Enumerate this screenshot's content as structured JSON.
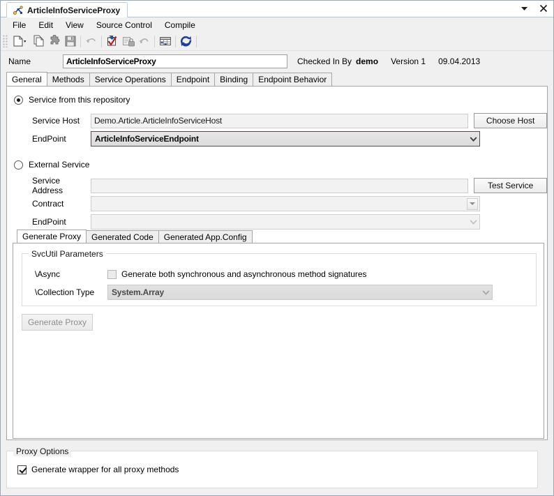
{
  "window": {
    "tab_title": "ArticleInfoServiceProxy",
    "tab_icon": "service-node-icon",
    "dropdown_icon": "chevron-down-icon",
    "close_icon": "close-icon"
  },
  "menu": {
    "items": [
      {
        "label": "File"
      },
      {
        "label": "Edit"
      },
      {
        "label": "View"
      },
      {
        "label": "Source Control"
      },
      {
        "label": "Compile"
      }
    ]
  },
  "toolbar": {
    "buttons": [
      {
        "name": "new-icon",
        "title": "New"
      },
      {
        "name": "copy-icon",
        "title": "Copy"
      },
      {
        "name": "plugin-icon",
        "title": "Add-in"
      },
      {
        "name": "save-icon",
        "title": "Save"
      },
      {
        "name": "undo-icon",
        "title": "Undo"
      },
      {
        "name": "check-in-icon",
        "title": "Check In"
      },
      {
        "name": "check-out-lock-icon",
        "title": "Check Out"
      },
      {
        "name": "undo-checkout-icon",
        "title": "Undo Check Out"
      },
      {
        "name": "grid-icon",
        "title": "Grid"
      },
      {
        "name": "refresh-icon",
        "title": "Refresh"
      }
    ]
  },
  "name_row": {
    "label": "Name",
    "value": "ArticleInfoServiceProxy",
    "placeholder": "",
    "checked_in_by_label": "Checked In By",
    "checked_in_by_user": "demo",
    "version": "Version 1",
    "date": "09.04.2013"
  },
  "tabs": {
    "items": [
      {
        "label": "General",
        "active": true
      },
      {
        "label": "Methods",
        "active": false
      },
      {
        "label": "Service Operations",
        "active": false
      },
      {
        "label": "Endpoint",
        "active": false
      },
      {
        "label": "Binding",
        "active": false
      },
      {
        "label": "Endpoint Behavior",
        "active": false
      }
    ]
  },
  "general": {
    "repository_radio": {
      "label": "Service from this repository",
      "checked": true
    },
    "service_host": {
      "label": "Service Host",
      "value": "Demo.Article.ArticleInfoServiceHost",
      "placeholder": ""
    },
    "choose_host_button": "Choose Host",
    "endpoint": {
      "label": "EndPoint",
      "value": "ArticleInfoServiceEndpoint",
      "chevron": "chevron-down-icon"
    },
    "external_radio": {
      "label": "External Service",
      "checked": false
    },
    "service_address": {
      "label": "Service Address",
      "value": "",
      "placeholder": ""
    },
    "test_service_button": "Test Service",
    "contract": {
      "label": "Contract",
      "value": "",
      "chevron": "triangle-down-icon"
    },
    "external_endpoint": {
      "label": "EndPoint",
      "value": "",
      "chevron": "chevron-down-icon"
    }
  },
  "inner_tabs": {
    "items": [
      {
        "label": "Generate Proxy",
        "active": true
      },
      {
        "label": "Generated Code",
        "active": false
      },
      {
        "label": "Generated App.Config",
        "active": false
      }
    ]
  },
  "generate_proxy": {
    "group_title": "SvcUtil Parameters",
    "async": {
      "label": "\\Async",
      "checkbox_label": "Generate both synchronous and asynchronous method signatures",
      "checked": false
    },
    "collection_type": {
      "label": "\\Collection Type",
      "value": "System.Array",
      "chevron": "chevron-down-icon"
    },
    "generate_button": "Generate Proxy"
  },
  "proxy_options": {
    "group_title": "Proxy Options",
    "wrapper_checkbox": {
      "label": "Generate wrapper for all proxy methods",
      "checked": true
    }
  },
  "colors": {
    "window_bg": "#f0f0f0",
    "page_bg": "#ffffff",
    "accent_border": "#5b4b4b",
    "titlebar_underline": "#b4c3d4",
    "disabled_text": "#9a9a9a",
    "icon_blue": "#2a4b9b",
    "icon_red": "#c1121f",
    "icon_yellow": "#f2c12e"
  }
}
